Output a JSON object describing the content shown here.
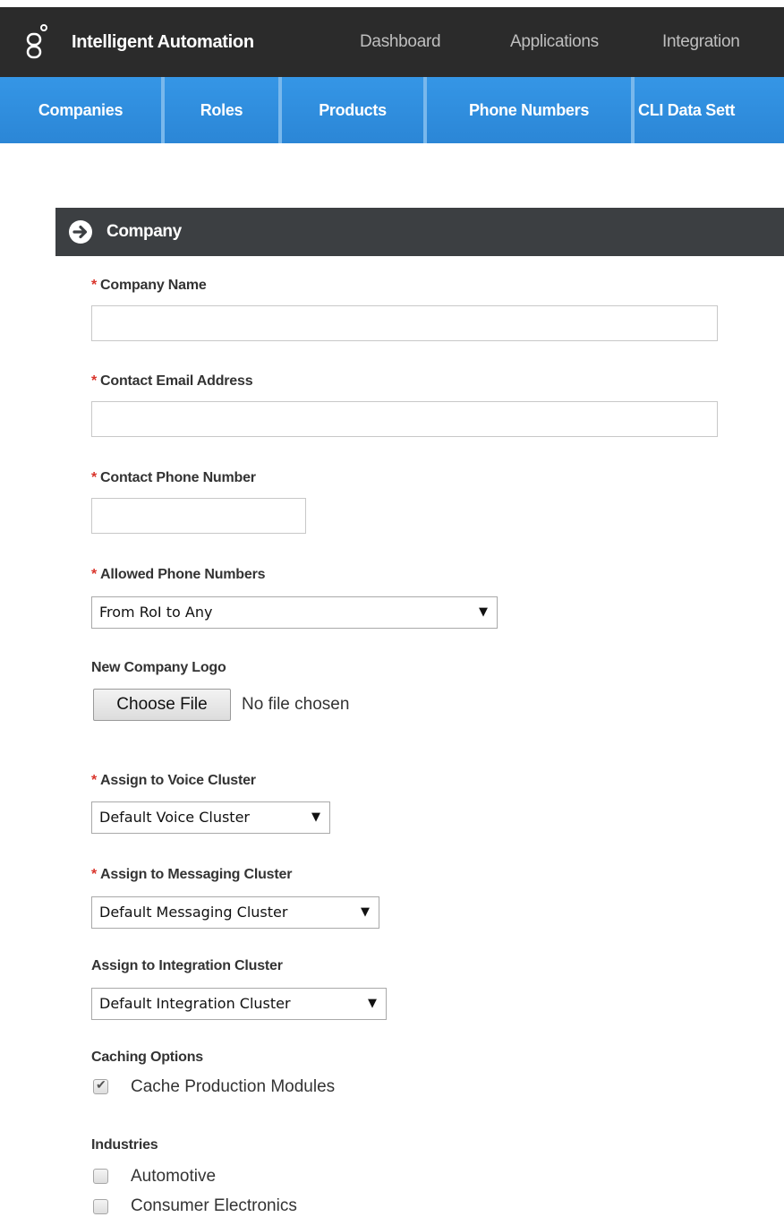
{
  "app": {
    "title": "Intelligent Automation"
  },
  "top_nav": [
    {
      "label": "Dashboard"
    },
    {
      "label": "Applications"
    },
    {
      "label": "Integration"
    }
  ],
  "sub_nav": [
    {
      "label": "Companies"
    },
    {
      "label": "Roles"
    },
    {
      "label": "Products"
    },
    {
      "label": "Phone Numbers"
    },
    {
      "label": "CLI Data Sett"
    }
  ],
  "panel": {
    "title": "Company",
    "icon": "arrow-circle-right-icon"
  },
  "form": {
    "required_marker": "*",
    "company_name": {
      "label": "Company Name",
      "value": ""
    },
    "contact_email": {
      "label": "Contact Email Address",
      "value": ""
    },
    "contact_phone": {
      "label": "Contact Phone Number",
      "value": ""
    },
    "allowed_phone_numbers": {
      "label": "Allowed Phone Numbers",
      "selected": "From RoI to Any"
    },
    "company_logo": {
      "label": "New Company Logo",
      "button": "Choose File",
      "status": "No file chosen"
    },
    "voice_cluster": {
      "label": "Assign to Voice Cluster",
      "selected": "Default Voice Cluster"
    },
    "messaging_cluster": {
      "label": "Assign to Messaging Cluster",
      "selected": "Default Messaging Cluster"
    },
    "integration_cluster": {
      "label": "Assign to Integration Cluster",
      "selected": "Default Integration Cluster"
    },
    "caching": {
      "label": "Caching Options",
      "options": [
        {
          "label": "Cache Production Modules",
          "checked": true
        }
      ]
    },
    "industries": {
      "label": "Industries",
      "options": [
        {
          "label": "Automotive",
          "checked": false
        },
        {
          "label": "Consumer Electronics",
          "checked": false
        }
      ]
    }
  },
  "colors": {
    "topbar": "#2b2b2b",
    "subbar": "#2f8fe0",
    "panel_header": "#3c3f42",
    "required": "#d9342b"
  }
}
